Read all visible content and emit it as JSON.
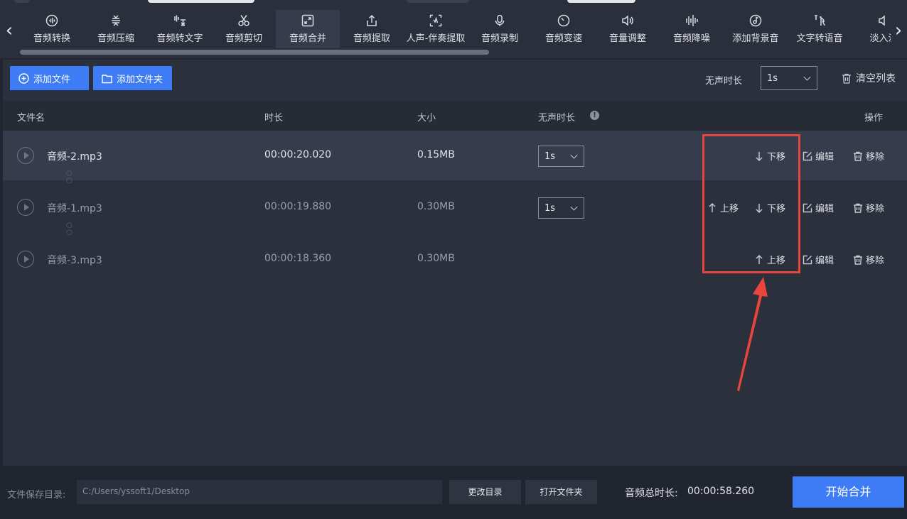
{
  "toolbar": {
    "tools": [
      {
        "label": "音频转换",
        "icon": "wave-circle-icon"
      },
      {
        "label": "音频压缩",
        "icon": "compress-icon"
      },
      {
        "label": "音频转文字",
        "icon": "speech-text-icon"
      },
      {
        "label": "音频剪切",
        "icon": "scissors-icon"
      },
      {
        "label": "音频合并",
        "icon": "merge-icon",
        "active": true
      },
      {
        "label": "音频提取",
        "icon": "export-icon"
      },
      {
        "label": "人声-伴奏提取",
        "icon": "vocal-extract-icon"
      },
      {
        "label": "音频录制",
        "icon": "microphone-icon"
      },
      {
        "label": "音频变速",
        "icon": "speedometer-icon"
      },
      {
        "label": "音量调整",
        "icon": "volume-icon"
      },
      {
        "label": "音频降噪",
        "icon": "noise-bars-icon"
      },
      {
        "label": "添加背景音",
        "icon": "music-disc-icon"
      },
      {
        "label": "文字转语音",
        "icon": "text-speech-icon"
      },
      {
        "label": "淡入淡",
        "icon": "fade-icon"
      }
    ]
  },
  "actions": {
    "add_file": "添加文件",
    "add_folder": "添加文件夹",
    "silence_label": "无声时长",
    "silence_value": "1s",
    "clear_list": "清空列表"
  },
  "table": {
    "headers": {
      "name": "文件名",
      "duration": "时长",
      "size": "大小",
      "silence": "无声时长",
      "ops": "操作"
    },
    "rows": [
      {
        "name": "音频-2.mp3",
        "duration": "00:00:20.020",
        "size": "0.15MB",
        "silence": "1s",
        "up": "",
        "down": "下移",
        "edit": "编辑",
        "remove": "移除"
      },
      {
        "name": "音频-1.mp3",
        "duration": "00:00:19.880",
        "size": "0.30MB",
        "silence": "1s",
        "up": "上移",
        "down": "下移",
        "edit": "编辑",
        "remove": "移除"
      },
      {
        "name": "音频-3.mp3",
        "duration": "00:00:18.360",
        "size": "0.30MB",
        "silence": "",
        "up": "上移",
        "down": "",
        "edit": "编辑",
        "remove": "移除"
      }
    ]
  },
  "footer": {
    "save_label": "文件保存目录:",
    "save_path": "C:/Users/yssoft1/Desktop",
    "change_dir": "更改目录",
    "open_folder": "打开文件夹",
    "total_label": "音频总时长:",
    "total_value": "00:00:58.260",
    "start": "开始合并"
  },
  "colors": {
    "accent": "#3d7cf5",
    "annotation": "#e8453c",
    "background": "#21252f"
  }
}
